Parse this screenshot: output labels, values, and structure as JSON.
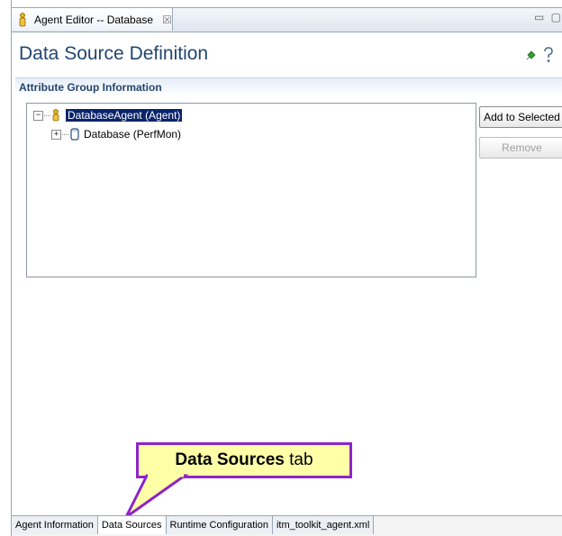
{
  "editor": {
    "tab_title": "Agent Editor -- Database",
    "tab_close": "☒",
    "window_controls": "▭ ▢"
  },
  "page": {
    "title": "Data Source Definition",
    "icons": [
      "pin-icon",
      "help-icon"
    ]
  },
  "section": {
    "title": "Attribute Group Information"
  },
  "tree": {
    "nodes": [
      {
        "label": "DatabaseAgent (Agent)",
        "expander": "−",
        "icon": "agent-icon",
        "selected": true
      },
      {
        "label": "Database (PerfMon)",
        "expander": "+",
        "icon": "datasource-icon",
        "selected": false
      }
    ]
  },
  "buttons": {
    "add_to_selected": "Add to Selected",
    "remove": "Remove"
  },
  "callout": {
    "bold": "Data Sources",
    "rest": " tab"
  },
  "bottom_tabs": [
    {
      "label": "Agent Information",
      "active": false
    },
    {
      "label": "Data Sources",
      "active": true
    },
    {
      "label": "Runtime Configuration",
      "active": false
    },
    {
      "label": "itm_toolkit_agent.xml",
      "active": false
    }
  ],
  "colors": {
    "title": "#23456e",
    "selection": "#0a246a",
    "callout_border": "#8e24c8",
    "callout_fill": "#ffffa8"
  }
}
